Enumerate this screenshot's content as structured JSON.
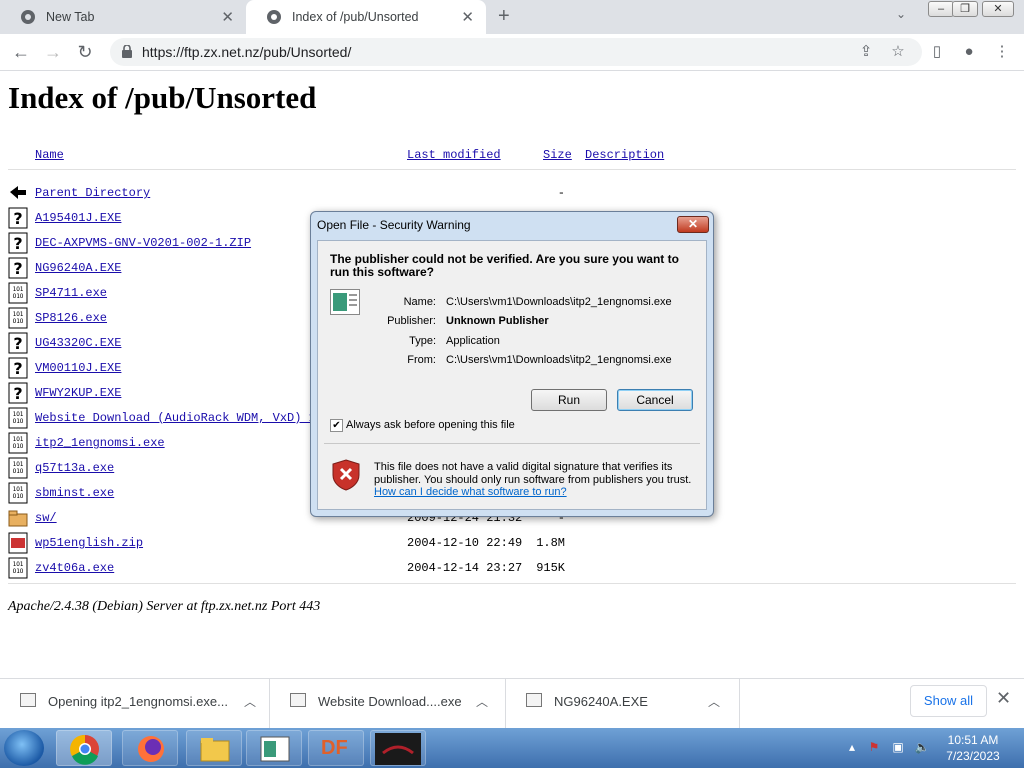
{
  "tabs": [
    {
      "label": "New Tab",
      "active": false
    },
    {
      "label": "Index of /pub/Unsorted",
      "active": true
    }
  ],
  "address_bar": {
    "url": "https://ftp.zx.net.nz/pub/Unsorted/"
  },
  "page": {
    "title": "Index of /pub/Unsorted",
    "columns": {
      "name": "Name",
      "last_modified": "Last modified",
      "size": "Size",
      "description": "Description"
    },
    "rows": [
      {
        "name": "Parent Directory",
        "date": "",
        "size": "-",
        "icon": "back-icon"
      },
      {
        "name": "A195401J.EXE",
        "date": "",
        "size": "",
        "icon": "unknown-file-icon"
      },
      {
        "name": "DEC-AXPVMS-GNV-V0201-002-1.ZIP",
        "date": "",
        "size": "",
        "icon": "unknown-file-icon"
      },
      {
        "name": "NG96240A.EXE",
        "date": "",
        "size": "",
        "icon": "unknown-file-icon"
      },
      {
        "name": "SP4711.exe",
        "date": "",
        "size": "",
        "icon": "binary-file-icon"
      },
      {
        "name": "SP8126.exe",
        "date": "",
        "size": "",
        "icon": "binary-file-icon"
      },
      {
        "name": "UG43320C.EXE",
        "date": "",
        "size": "",
        "icon": "unknown-file-icon"
      },
      {
        "name": "VM00110J.EXE",
        "date": "",
        "size": "",
        "icon": "unknown-file-icon"
      },
      {
        "name": "WFWY2KUP.EXE",
        "date": "",
        "size": "",
        "icon": "unknown-file-icon"
      },
      {
        "name": "Website Download (AudioRack WDM, VxD) 1",
        "date": "",
        "size": "",
        "icon": "binary-file-icon"
      },
      {
        "name": "itp2_1engnomsi.exe",
        "date": "",
        "size": "",
        "icon": "binary-file-icon"
      },
      {
        "name": "q57t13a.exe",
        "date": "",
        "size": "",
        "icon": "binary-file-icon"
      },
      {
        "name": "sbminst.exe",
        "date": "",
        "size": "",
        "icon": "binary-file-icon"
      },
      {
        "name": "sw/",
        "date": "2009-12-24 21:32",
        "size": "-",
        "icon": "folder-icon"
      },
      {
        "name": "wp51english.zip",
        "date": "2004-12-10 22:49",
        "size": "1.8M",
        "icon": "compressed-file-icon"
      },
      {
        "name": "zv4t06a.exe",
        "date": "2004-12-14 23:27",
        "size": "915K",
        "icon": "binary-file-icon"
      }
    ],
    "footer": "Apache/2.4.38 (Debian) Server at ftp.zx.net.nz Port 443"
  },
  "dialog": {
    "title": "Open File - Security Warning",
    "question": "The publisher could not be verified.  Are you sure you want to run this software?",
    "fields": [
      {
        "label": "Name:",
        "value": "C:\\Users\\vm1\\Downloads\\itp2_1engnomsi.exe",
        "bold": false
      },
      {
        "label": "Publisher:",
        "value": "Unknown Publisher",
        "bold": true
      },
      {
        "label": "Type:",
        "value": "Application",
        "bold": false
      },
      {
        "label": "From:",
        "value": "C:\\Users\\vm1\\Downloads\\itp2_1engnomsi.exe",
        "bold": false
      }
    ],
    "run_label": "Run",
    "cancel_label": "Cancel",
    "checkbox_label": "Always ask before opening this file",
    "checkbox_checked": true,
    "warning_text": "This file does not have a valid digital signature that verifies its publisher.  You should only run software from publishers you trust.",
    "warning_link": "How can I decide what software to run?"
  },
  "downloads": [
    {
      "name": "Opening itp2_1engnomsi.exe..."
    },
    {
      "name": "Website Download....exe"
    },
    {
      "name": "NG96240A.EXE"
    }
  ],
  "downloads_show_all": "Show all",
  "taskbar": {
    "time": "10:51 AM",
    "date": "7/23/2023",
    "apps": [
      "chrome",
      "firefox",
      "file-explorer",
      "application-window",
      "DF",
      "media-app"
    ],
    "df_label": "DF"
  }
}
